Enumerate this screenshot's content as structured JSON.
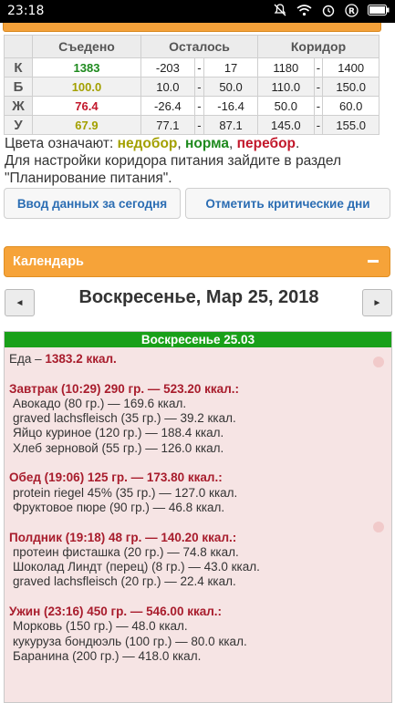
{
  "status_bar": {
    "time": "23:18",
    "icons": [
      "mute-icon",
      "wifi-icon",
      "alarm-icon",
      "registered-icon",
      "battery-icon"
    ]
  },
  "macro_table": {
    "headers": [
      "",
      "Съедено",
      "Осталось",
      "",
      "",
      "Коридор",
      "",
      ""
    ],
    "rows": [
      {
        "label": "К",
        "eaten": "1383",
        "eaten_color": "green",
        "rem_from": "-203",
        "dash1": "-",
        "rem_to": "17",
        "cor_from": "1180",
        "dash2": "-",
        "cor_to": "1400"
      },
      {
        "label": "Б",
        "eaten": "100.0",
        "eaten_color": "olive",
        "rem_from": "10.0",
        "dash1": "-",
        "rem_to": "50.0",
        "cor_from": "110.0",
        "dash2": "-",
        "cor_to": "150.0"
      },
      {
        "label": "Ж",
        "eaten": "76.4",
        "eaten_color": "red",
        "rem_from": "-26.4",
        "dash1": "-",
        "rem_to": "-16.4",
        "cor_from": "50.0",
        "dash2": "-",
        "cor_to": "60.0"
      },
      {
        "label": "У",
        "eaten": "67.9",
        "eaten_color": "olive",
        "rem_from": "77.1",
        "dash1": "-",
        "rem_to": "87.1",
        "cor_from": "145.0",
        "dash2": "-",
        "cor_to": "155.0"
      }
    ]
  },
  "legend": {
    "prefix": "Цвета означают: ",
    "under": "недобор",
    "sep1": ", ",
    "norm": "норма",
    "sep2": ", ",
    "over": "перебор",
    "suffix": ".",
    "line2": "Для настройки коридора питания зайдите в раздел",
    "line3": "\"Планирование питания\"."
  },
  "buttons": {
    "input_today": "Ввод данных за сегодня",
    "mark_critical": "Отметить критические дни"
  },
  "calendar": {
    "title": "Календарь",
    "collapse": "−",
    "prev": "◄",
    "next": "►",
    "date": "Воскресенье, Мар 25, 2018"
  },
  "day": {
    "header": "Воскресенье 25.03",
    "food_total_label": "Еда – ",
    "food_total_value": "1383.2 ккал.",
    "meals": [
      {
        "title": "Завтрак (10:29) 290 гр. — 523.20 ккал.:",
        "items": [
          "Авокадо (80 гр.) — 169.6 ккал.",
          "graved lachsfleisch (35 гр.) — 39.2 ккал.",
          "Яйцо куриное (120 гр.) — 188.4 ккал.",
          "Хлеб зерновой (55 гр.) — 126.0 ккал."
        ]
      },
      {
        "title": "Обед (19:06) 125 гр. — 173.80 ккал.:",
        "items": [
          "protein riegel 45% (35 гр.) — 127.0 ккал.",
          "Фруктовое пюре (90 гр.) — 46.8 ккал."
        ]
      },
      {
        "title": "Полдник (19:18) 48 гр. — 140.20 ккал.:",
        "items": [
          "протеин фисташка (20 гр.) — 74.8 ккал.",
          "Шоколад Линдт (перец) (8 гр.) — 43.0 ккал.",
          "graved lachsfleisch (20 гр.) — 22.4 ккал."
        ]
      },
      {
        "title": "Ужин (23:16) 450 гр. — 546.00 ккал.:",
        "items": [
          "Морковь (150 гр.) — 48.0 ккал.",
          "кукуруза бондюэль (100 гр.) — 80.0 ккал.",
          "Баранина (200 гр.) — 418.0 ккал."
        ]
      }
    ]
  },
  "colors": {
    "accent_orange": "#f6a339",
    "day_header_green": "#19a019",
    "day_bg_pink": "#f6e4e4",
    "meal_red": "#a81c2c"
  }
}
